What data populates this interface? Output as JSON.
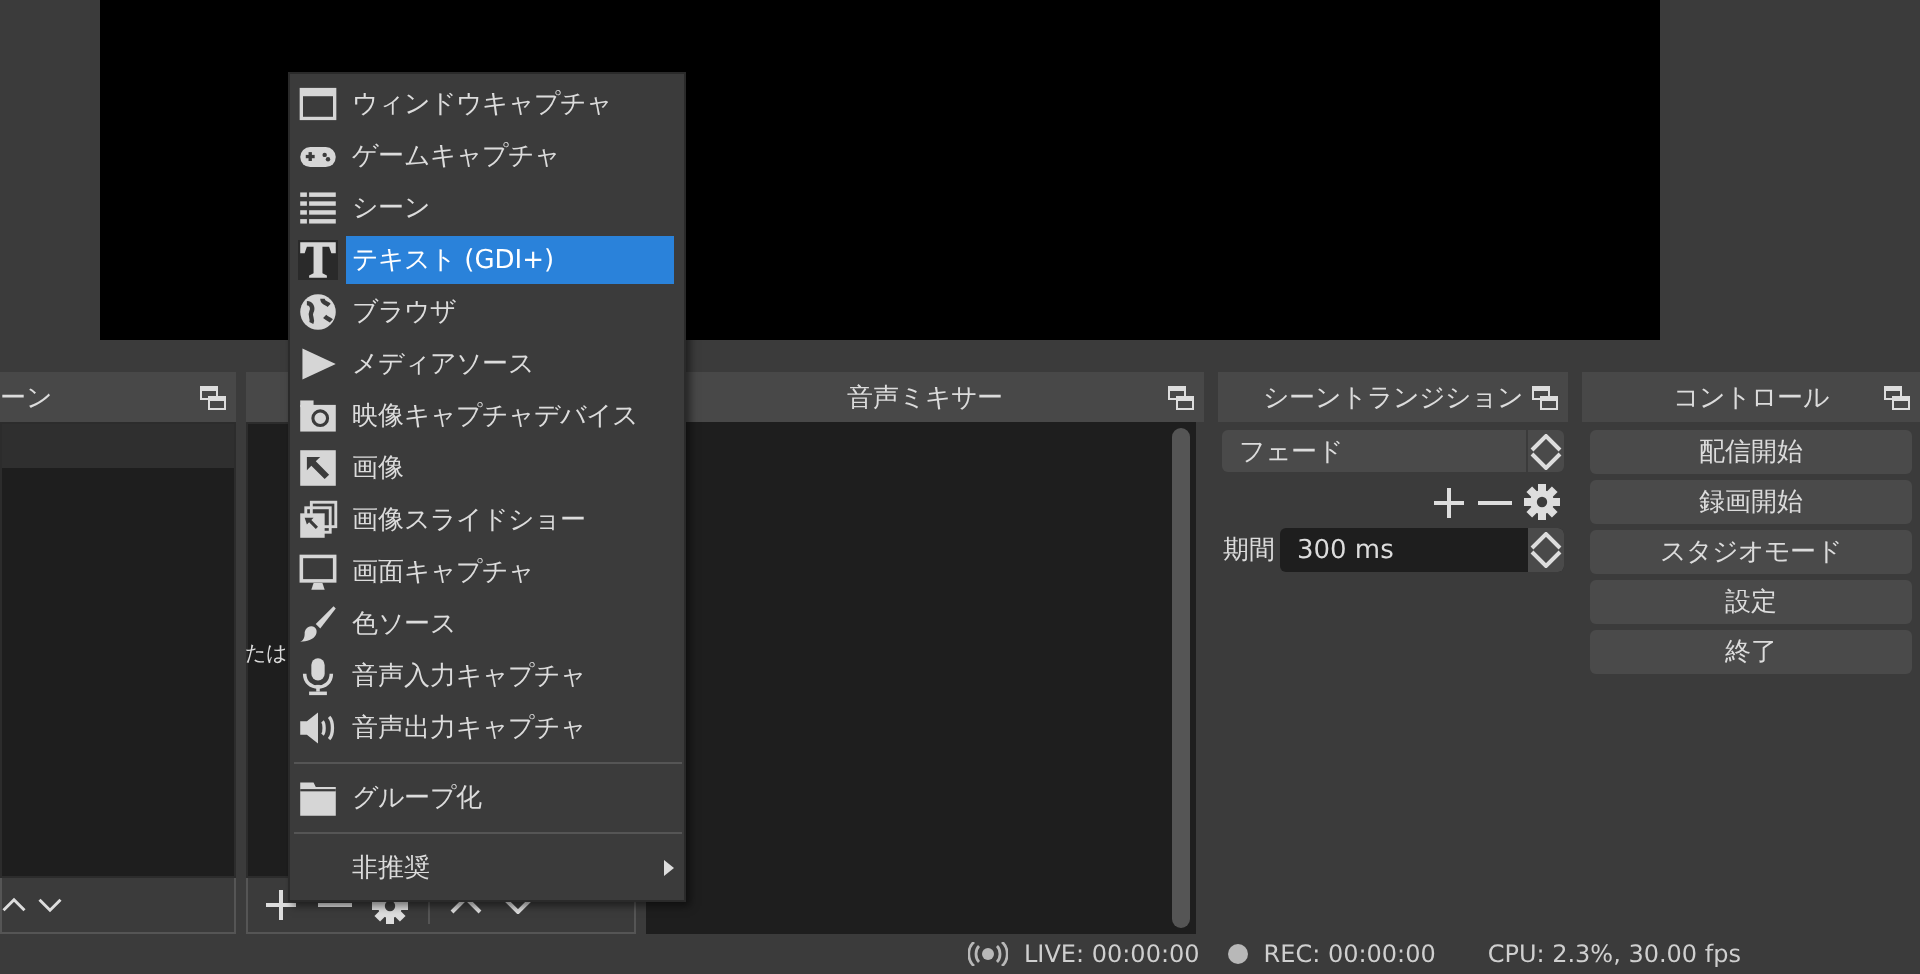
{
  "scenes_dock": {
    "title": "ーン"
  },
  "sources_dock": {
    "hint_fragment": "たは"
  },
  "audio_mixer": {
    "title": "音声ミキサー"
  },
  "scene_transitions": {
    "title": "シーントランジション",
    "transition": "フェード",
    "duration_label": "期間",
    "duration": "300 ms"
  },
  "controls": {
    "title": "コントロール",
    "buttons": [
      "配信開始",
      "録画開始",
      "スタジオモード",
      "設定",
      "終了"
    ]
  },
  "context_menu": {
    "items": [
      {
        "kind": "item",
        "label": "ウィンドウキャプチャ",
        "selected": false
      },
      {
        "kind": "item",
        "label": "ゲームキャプチャ",
        "selected": false
      },
      {
        "kind": "item",
        "label": "シーン",
        "selected": false
      },
      {
        "kind": "item",
        "label": "テキスト (GDI+)",
        "selected": true
      },
      {
        "kind": "item",
        "label": "ブラウザ",
        "selected": false
      },
      {
        "kind": "item",
        "label": "メディアソース",
        "selected": false
      },
      {
        "kind": "item",
        "label": "映像キャプチャデバイス",
        "selected": false
      },
      {
        "kind": "item",
        "label": "画像",
        "selected": false
      },
      {
        "kind": "item",
        "label": "画像スライドショー",
        "selected": false
      },
      {
        "kind": "item",
        "label": "画面キャプチャ",
        "selected": false
      },
      {
        "kind": "item",
        "label": "色ソース",
        "selected": false
      },
      {
        "kind": "item",
        "label": "音声入力キャプチャ",
        "selected": false
      },
      {
        "kind": "item",
        "label": "音声出力キャプチャ",
        "selected": false
      },
      {
        "kind": "separator"
      },
      {
        "kind": "item",
        "label": "グループ化",
        "selected": false
      },
      {
        "kind": "separator"
      },
      {
        "kind": "submenu",
        "label": "非推奨",
        "selected": false
      }
    ]
  },
  "status_bar": {
    "live": "LIVE: 00:00:00",
    "rec": "REC: 00:00:00",
    "cpu": "CPU: 2.3%, 30.00 fps"
  }
}
